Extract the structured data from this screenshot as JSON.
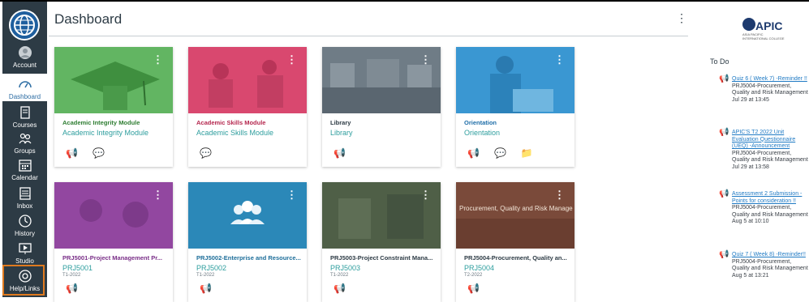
{
  "nav": {
    "items": [
      {
        "label": "Account"
      },
      {
        "label": "Dashboard"
      },
      {
        "label": "Courses"
      },
      {
        "label": "Groups"
      },
      {
        "label": "Calendar"
      },
      {
        "label": "Inbox"
      },
      {
        "label": "History"
      },
      {
        "label": "Studio"
      },
      {
        "label": "Help/Links"
      }
    ]
  },
  "header": {
    "title": "Dashboard",
    "menu": "⋮"
  },
  "cards": [
    {
      "title": "Academic Integrity Module",
      "subtitle": "Academic Integrity Module",
      "term": "",
      "color": "#4caf50",
      "title_color": "#2e7d32"
    },
    {
      "title": "Academic Skills Module",
      "subtitle": "Academic Skills Module",
      "term": "",
      "color": "#d63a6b",
      "title_color": "#b5284f"
    },
    {
      "title": "Library",
      "subtitle": "Library",
      "term": "",
      "color": "#6b7a86",
      "title_color": "#2d3b45"
    },
    {
      "title": "Orientation",
      "subtitle": "Orientation",
      "term": "",
      "color": "#2e8bc9",
      "title_color": "#1f6ea8"
    },
    {
      "title": "PRJ5001-Project Management Pr...",
      "subtitle": "PRJ5001",
      "term": "T1-2022",
      "color": "#8e3f9c",
      "title_color": "#7a2f88"
    },
    {
      "title": "PRJ5002-Enterprise and Resource...",
      "subtitle": "PRJ5002",
      "term": "T1-2022",
      "color": "#2b88b8",
      "title_color": "#1d6e9a"
    },
    {
      "title": "PRJ5003-Project Constraint Mana...",
      "subtitle": "PRJ5003",
      "term": "T1-2022",
      "color": "#4d5d45",
      "title_color": "#2d3b45"
    },
    {
      "title": "PRJ5004-Procurement, Quality an...",
      "subtitle": "PRJ5004",
      "term": "T2-2022",
      "color": "#7a4a3a",
      "title_color": "#2d3b45"
    }
  ],
  "card_hero_text": {
    "prj5004": "Procurement, Quality and Risk Management"
  },
  "brand": {
    "name": "APIC",
    "tagline": "ASIA PACIFIC INTERNATIONAL COLLEGE"
  },
  "todo": {
    "heading": "To Do",
    "items": [
      {
        "link": "Quiz 6 ( Week 7) -Reminder !!",
        "course": "PRJ5004-Procurement, Quality and Risk Management",
        "date": "Jul 29 at 13:45"
      },
      {
        "link": "APIC'S T2 2022 Unit Evaluation Questionnaire (UEQ) -Announcement",
        "course": "PRJ5004-Procurement, Quality and Risk Management",
        "date": "Jul 29 at 13:58"
      },
      {
        "link": "Assessment 2 Submission -Points for consideration !!",
        "course": "PRJ5004-Procurement, Quality and Risk Management",
        "date": "Aug 5 at 10:10"
      },
      {
        "link": "Quiz 7 ( Week 8) -Reminder!!",
        "course": "PRJ5004-Procurement, Quality and Risk Management",
        "date": "Aug 5 at 13:21"
      }
    ]
  },
  "colors": {
    "nav_bg": "#2d3b45",
    "accent": "#2d6da3",
    "help_highlight": "#e07a1f"
  }
}
